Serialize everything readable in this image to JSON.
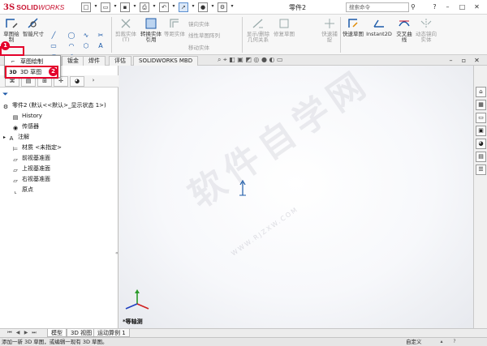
{
  "app": {
    "brand_ds": "3S",
    "brand_solid": "SOLID",
    "brand_works": "WORKS"
  },
  "document_title": "零件2",
  "search": {
    "placeholder": "搜索命令"
  },
  "ribbon": {
    "sketch_draw": "草图绘制",
    "smart_dimension": "智能尺寸",
    "trim_entities": "剪裁实体(T)",
    "convert_entities": "转换实体引用",
    "offset_entities": "等距实体",
    "mirror_entities": "镜向实体",
    "linear_pattern": "线性草图阵列",
    "move_entities": "移动实体",
    "display_relations": "显示/删除几何关系",
    "repair_sketch": "修复草图",
    "quick_snaps": "快速捕捉",
    "rapid_sketch": "快速草图",
    "instant2d": "Instant2D",
    "cross_curve": "交叉曲线",
    "dynamic_mirror": "动态镜向实体"
  },
  "tabs": [
    "钣金",
    "焊件",
    "评估",
    "SOLIDWORKS MBD"
  ],
  "dropdown_menu": {
    "item_sketch": "草图绘制",
    "item_3dsketch": "3D 草图",
    "badge1": "1",
    "badge2": "2"
  },
  "feature_tree": {
    "root": "零件2 (默认<<默认>_显示状态 1>)",
    "items": [
      "History",
      "传感器",
      "注解",
      "材质 <未指定>",
      "前视基准面",
      "上视基准面",
      "右视基准面",
      "原点"
    ]
  },
  "viewport": {
    "view_label": "*等轴测",
    "watermark": "软件自学网",
    "watermark_url": "WWW.RJZXW.COM"
  },
  "bottom_tabs": [
    "模型",
    "3D 视图",
    "运动算例 1"
  ],
  "status": {
    "message": "添加一新 3D 草图，或编辑一现有 3D 草图。",
    "custom": "自定义"
  },
  "colors": {
    "brand_red": "#c8102e",
    "highlight_red": "#e4002b",
    "icon_blue": "#1c5aa8"
  }
}
